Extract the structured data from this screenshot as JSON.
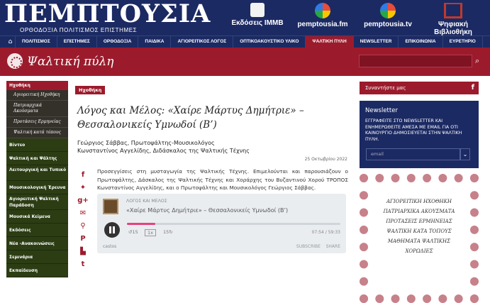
{
  "header": {
    "logo_title": "ΠΕΜΠΤΟΥΣΙΑ",
    "logo_subtitle": "ΟΡΘΟΔΟΞΙΑ ΠΟΛΙΤΙΣΜΟΣ ΕΠΙΣΤΗΜΕΣ",
    "links": [
      {
        "label": "Εκδόσεις ΙΜΜΒ",
        "icon": "book-icon"
      },
      {
        "label": "pemptousia.fm",
        "icon": "radio-icon"
      },
      {
        "label": "pemptousia.tv",
        "icon": "tv-icon"
      },
      {
        "label": "Ψηφιακή Βιβλιοθήκη",
        "icon": "library-icon"
      }
    ]
  },
  "nav": {
    "items": [
      "ΠΟΛΙΤΙΣΜΟΣ",
      "ΕΠΙΣΤΗΜΕΣ",
      "ΟΡΘΟΔΟΞΙΑ",
      "ΠΑΙΔΙΚΑ",
      "ΑΓΙΟΡΕΙΤΙΚΟΣ ΛΟΓΟΣ",
      "ΟΠΤΙΚΟΑΚΟΥΣΤΙΚΟ ΥΛΙΚΟ",
      "ΨΑΛΤΙΚΗ ΠΥΛΗ",
      "NEWSLETTER",
      "ΕΠΙΚΟΙΝΩΝΙΑ",
      "ΕΥΡΕΤΗΡΙΟ"
    ],
    "active_index": 6
  },
  "brand": {
    "name": "Ψαλτική πύλη"
  },
  "sidebar": {
    "items": [
      {
        "label": "Ηχοθήκη",
        "kind": "head"
      },
      {
        "label": "Αγιορειτική Ηχοθήκη",
        "kind": "sub"
      },
      {
        "label": "Πατριαρχικά Ακούσματα",
        "kind": "sub"
      },
      {
        "label": "Προτάσεις Ερμηνείας",
        "kind": "sub"
      },
      {
        "label": "Ψαλτική κατά τόπους",
        "kind": "sub"
      },
      {
        "label": "Βίντεο",
        "kind": "main"
      },
      {
        "label": "Ψαλτική και Ψάλτης",
        "kind": "main"
      },
      {
        "label": "Λειτουργική και Τυπικό",
        "kind": "main"
      },
      {
        "label": "Μουσικολογική Έρευνα",
        "kind": "main"
      },
      {
        "label": "Αγιορειτική Ψαλτική Παράδοση",
        "kind": "main"
      },
      {
        "label": "Μουσικά Κείμενα",
        "kind": "main"
      },
      {
        "label": "Εκδόσεις",
        "kind": "main"
      },
      {
        "label": "Νέα -Ανακοινώσεις",
        "kind": "main"
      },
      {
        "label": "Σεμινάρια",
        "kind": "main"
      },
      {
        "label": "Εκπαίδευση",
        "kind": "main"
      }
    ]
  },
  "article": {
    "tag": "Ηχοθήκη",
    "title": "Λόγος και Μέλος: «Χαίρε Μάρτυς Δημήτριε» – Θεσσαλονικείς Υμνωδοί (Β’)",
    "author1": "Γεώργιος Σάββας, Πρωτοψάλτης-Μουσικολόγος",
    "author2": "Κωνσταντίνος Αγγελίδης, Διδάσκαλος της Ψαλτικής Τέχνης",
    "date": "25 Οκτωβρίου 2022",
    "paragraph": "Προσεγγίσεις στη μυσταγωγία της Ψαλτικής Τέχνης. Επιμελούνται και παρουσιάζουν ο Πρωτοψάλτης, Δάσκαλος της Ψαλτικής Τέχνης και Χοράρχης του Βυζαντινού Χορού ΤΡΟΠΟΣ Κωνσταντίνος Αγγελίδης, και ο Πρωτοψάλτης και Μουσικολόγος Γεώργιος Σάββας."
  },
  "share_icons": [
    "facebook-icon",
    "twitter-icon",
    "googleplus-icon",
    "email-icon",
    "link-icon",
    "pinterest-icon",
    "flipboard-icon",
    "tumblr-icon"
  ],
  "player": {
    "show": "ΛΟΓΟΣ ΚΑΙ ΜΕΛΟΣ",
    "episode": "«Χαίρε Μάρτυς Δημήτριε» – Θεσσαλονικείς Υμνωδοί (Β’)",
    "back": "15",
    "speed": "1x",
    "forward": "15",
    "time": "07:54 / 59:33",
    "progress_fraction": 0.133,
    "brand": "castos",
    "subscribe": "SUBSCRIBE",
    "share": "SHARE",
    "accent": "#e6417e"
  },
  "right": {
    "follow": "Συναντήστε μας",
    "newsletter_title": "Newsletter",
    "newsletter_text": "ΕΓΓΡΑΦΕΙΤΕ ΣΤΟ NEWSLETTER ΚΑΙ ΕΝΗΜΕΡΩΘΕΙΤΕ ΑΜΕΣΑ ΜΕ EMAIL ΓΙΑ ΟΤΙ ΚΑΙΝΟΥΡΓΙΟ ΔΗΜΟΣΙΕΥΕΤΑΙ ΣΤΗΝ ΨΑΛΤΙΚΗ ΠΥΛΗ.",
    "email_placeholder": "email",
    "poster_lines": [
      "ΑΓΙΟΡΕΙΤΙΚΗ ΗΧΟΘΗΚΗ",
      "ΠΑΤΡΙΑΡΧΙΚΑ ΑΚΟΥΣΜΑΤΑ",
      "ΠΡΟΤΑΣΕΙΣ ΕΡΜΗΝΕΙΑΣ",
      "ΨΑΛΤΙΚΗ ΚΑΤΑ ΤΟΠΟΥΣ",
      "ΜΑΘΗΜΑΤΑ ΨΑΛΤΙΚΗΣ",
      "ΧΟΡΩΔΙΕΣ"
    ]
  },
  "colors": {
    "navy": "#1c2a63",
    "crimson": "#9b1b2c",
    "olive": "#2c3d14"
  }
}
